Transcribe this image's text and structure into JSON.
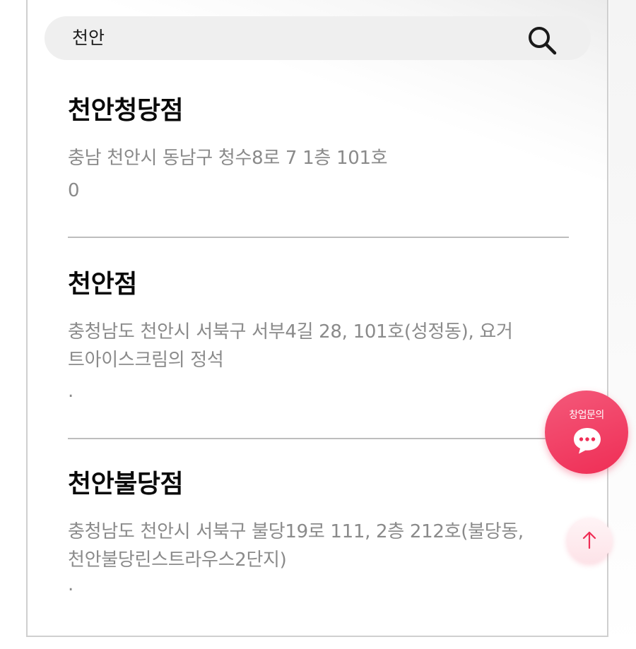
{
  "search": {
    "value": "천안"
  },
  "stores": [
    {
      "name": "천안청당점",
      "address": "충남 천안시 동남구 청수8로 7 1층 101호",
      "extra": "0"
    },
    {
      "name": "천안점",
      "address_lines": [
        "충청남도 천안시 서북구 서부4길 28, 101호(성정동), 요거",
        "트아이스크림의 정석"
      ],
      "extra": "."
    },
    {
      "name": "천안불당점",
      "address_lines": [
        "충청남도 천안시 서북구 불당19로 111, 2층 212호(불당동,",
        "천안불당린스트라우스2단지)"
      ],
      "extra": "."
    }
  ],
  "floating": {
    "consult_label": "창업문의",
    "consult_icon": "chat-bubble-icon",
    "top_icon": "arrow-up-icon"
  },
  "colors": {
    "accent": "#ef2d55",
    "muted_text": "#8a8a8a",
    "search_bg": "#efefef"
  }
}
